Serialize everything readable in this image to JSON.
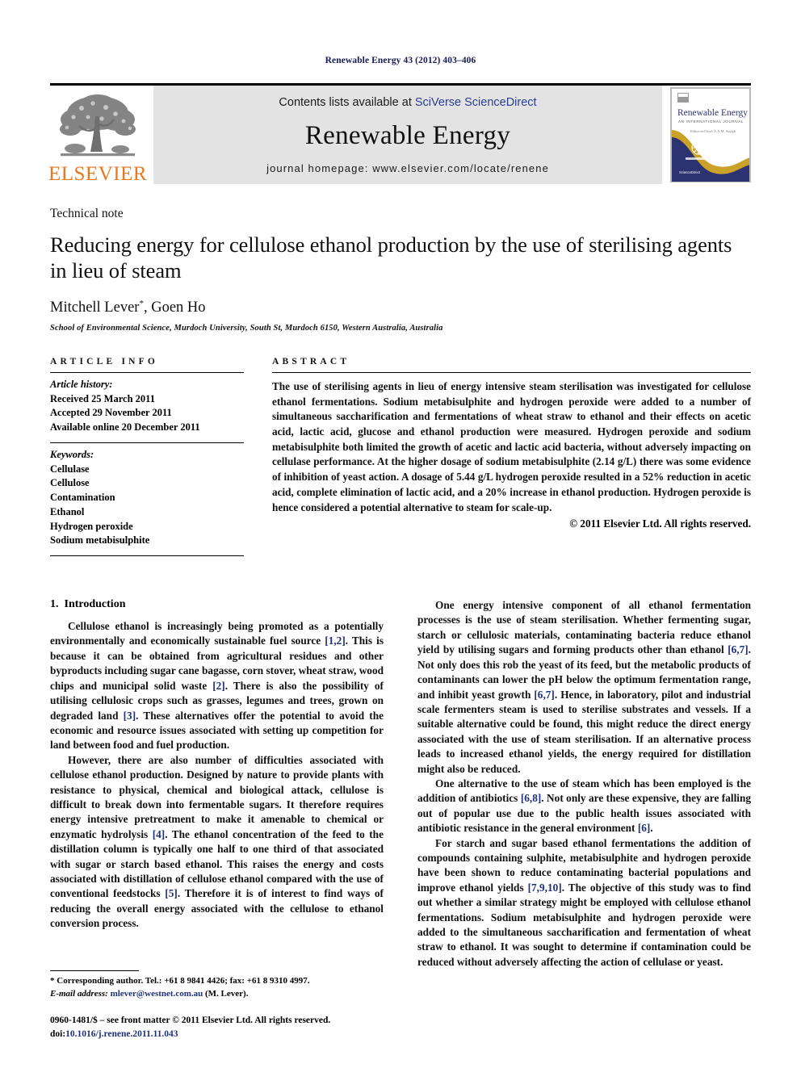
{
  "running_head": "Renewable Energy 43 (2012) 403–406",
  "masthead": {
    "publisher_name": "ELSEVIER",
    "contents_prefix": "Contents lists available at ",
    "contents_link": "SciVerse ScienceDirect",
    "journal_name": "Renewable Energy",
    "homepage_line": "journal homepage: www.elsevier.com/locate/renene",
    "cover": {
      "title": "Renewable Energy",
      "subtitle": "AN INTERNATIONAL JOURNAL",
      "editor": "Editor-in-Chief: A.A.M. Sayigh",
      "footer": "ScienceDirect"
    }
  },
  "article": {
    "doctype": "Technical note",
    "title": "Reducing energy for cellulose ethanol production by the use of sterilising agents in lieu of steam",
    "authors": "Mitchell Lever",
    "author_marker": "*",
    "authors_rest": ", Goen Ho",
    "affiliation": "School of Environmental Science, Murdoch University, South St, Murdoch 6150, Western Australia, Australia"
  },
  "article_info": {
    "heading": "ARTICLE INFO",
    "history_label": "Article history:",
    "history": [
      "Received 25 March 2011",
      "Accepted 29 November 2011",
      "Available online 20 December 2011"
    ],
    "keywords_label": "Keywords:",
    "keywords": [
      "Cellulase",
      "Cellulose",
      "Contamination",
      "Ethanol",
      "Hydrogen peroxide",
      "Sodium metabisulphite"
    ]
  },
  "abstract": {
    "heading": "ABSTRACT",
    "text": "The use of sterilising agents in lieu of energy intensive steam sterilisation was investigated for cellulose ethanol fermentations. Sodium metabisulphite and hydrogen peroxide were added to a number of simultaneous saccharification and fermentations of wheat straw to ethanol and their effects on acetic acid, lactic acid, glucose and ethanol production were measured. Hydrogen peroxide and sodium metabisulphite both limited the growth of acetic and lactic acid bacteria, without adversely impacting on cellulase performance. At the higher dosage of sodium metabisulphite (2.14 g/L) there was some evidence of inhibition of yeast action. A dosage of 5.44 g/L hydrogen peroxide resulted in a 52% reduction in acetic acid, complete elimination of lactic acid, and a 20% increase in ethanol production. Hydrogen peroxide is hence considered a potential alternative to steam for scale-up.",
    "copyright": "© 2011 Elsevier Ltd. All rights reserved."
  },
  "body": {
    "section_number": "1.",
    "section_title": "Introduction",
    "left_paragraphs": [
      {
        "pre": "Cellulose ethanol is increasingly being promoted as a potentially environmentally and economically sustainable fuel source ",
        "segments": [
          {
            "ref": "[1,2]",
            "text": ". This is because it can be obtained from agricultural residues and other byproducts including sugar cane bagasse, corn stover, wheat straw, wood chips and municipal solid waste "
          },
          {
            "ref": "[2]",
            "text": ". There is also the possibility of utilising cellulosic crops such as grasses, legumes and trees, grown on degraded land "
          },
          {
            "ref": "[3]",
            "text": ". These alternatives offer the potential to avoid the economic and resource issues associated with setting up competition for land between food and fuel production."
          }
        ]
      },
      {
        "pre": "However, there are also number of difficulties associated with cellulose ethanol production. Designed by nature to provide plants with resistance to physical, chemical and biological attack, cellulose is difficult to break down into fermentable sugars. It therefore requires energy intensive pretreatment to make it amenable to chemical or enzymatic hydrolysis ",
        "segments": [
          {
            "ref": "[4]",
            "text": ". The ethanol concentration of the feed to the distillation column is typically one half to one third of that associated with sugar or starch based ethanol. This raises the energy and costs associated with distillation of cellulose ethanol compared with the use of conventional feedstocks "
          },
          {
            "ref": "[5]",
            "text": ". Therefore it is of interest to find ways of reducing the overall energy associated with the cellulose to ethanol conversion process."
          }
        ]
      }
    ],
    "right_paragraphs": [
      {
        "pre": "One energy intensive component of all ethanol fermentation processes is the use of steam sterilisation. Whether fermenting sugar, starch or cellulosic materials, contaminating bacteria reduce ethanol yield by utilising sugars and forming products other than ethanol ",
        "segments": [
          {
            "ref": "[6,7]",
            "text": ". Not only does this rob the yeast of its feed, but the metabolic products of contaminants can lower the pH below the optimum fermentation range, and inhibit yeast growth "
          },
          {
            "ref": "[6,7]",
            "text": ". Hence, in laboratory, pilot and industrial scale fermenters steam is used to sterilise substrates and vessels. If a suitable alternative could be found, this might reduce the direct energy associated with the use of steam sterilisation. If an alternative process leads to increased ethanol yields, the energy required for distillation might also be reduced."
          }
        ]
      },
      {
        "pre": "One alternative to the use of steam which has been employed is the addition of antibiotics ",
        "segments": [
          {
            "ref": "[6,8]",
            "text": ". Not only are these expensive, they are falling out of popular use due to the public health issues associated with antibiotic resistance in the general environment "
          },
          {
            "ref": "[6]",
            "text": "."
          }
        ]
      },
      {
        "pre": "For starch and sugar based ethanol fermentations the addition of compounds containing sulphite, metabisulphite and hydrogen peroxide have been shown to reduce contaminating bacterial populations and improve ethanol yields ",
        "segments": [
          {
            "ref": "[7,9,10]",
            "text": ". The objective of this study was to find out whether a similar strategy might be employed with cellulose ethanol fermentations. Sodium metabisulphite and hydrogen peroxide were added to the simultaneous saccharification and fermentation of wheat straw to ethanol. It was sought to determine if contamination could be reduced without adversely affecting the action of cellulase or yeast."
          }
        ]
      }
    ]
  },
  "footnote": {
    "corresponding": "* Corresponding author. Tel.: +61 8 9841 4426; fax: +61 8 9310 4997.",
    "email_label": "E-mail address:",
    "email": "mlever@westnet.com.au",
    "email_suffix": " (M. Lever).",
    "issn_line": "0960-1481/$ – see front matter © 2011 Elsevier Ltd. All rights reserved.",
    "doi_label": "doi:",
    "doi_value": "10.1016/j.renene.2011.11.043"
  },
  "colors": {
    "link": "#2b3f92",
    "reference": "#1f2f7a",
    "running_head": "#161b55",
    "elsevier_orange": "#e87722",
    "banner_gray": "#e3e3e3",
    "cover_navy": "#2d3270",
    "cover_gold": "#c9a227"
  }
}
